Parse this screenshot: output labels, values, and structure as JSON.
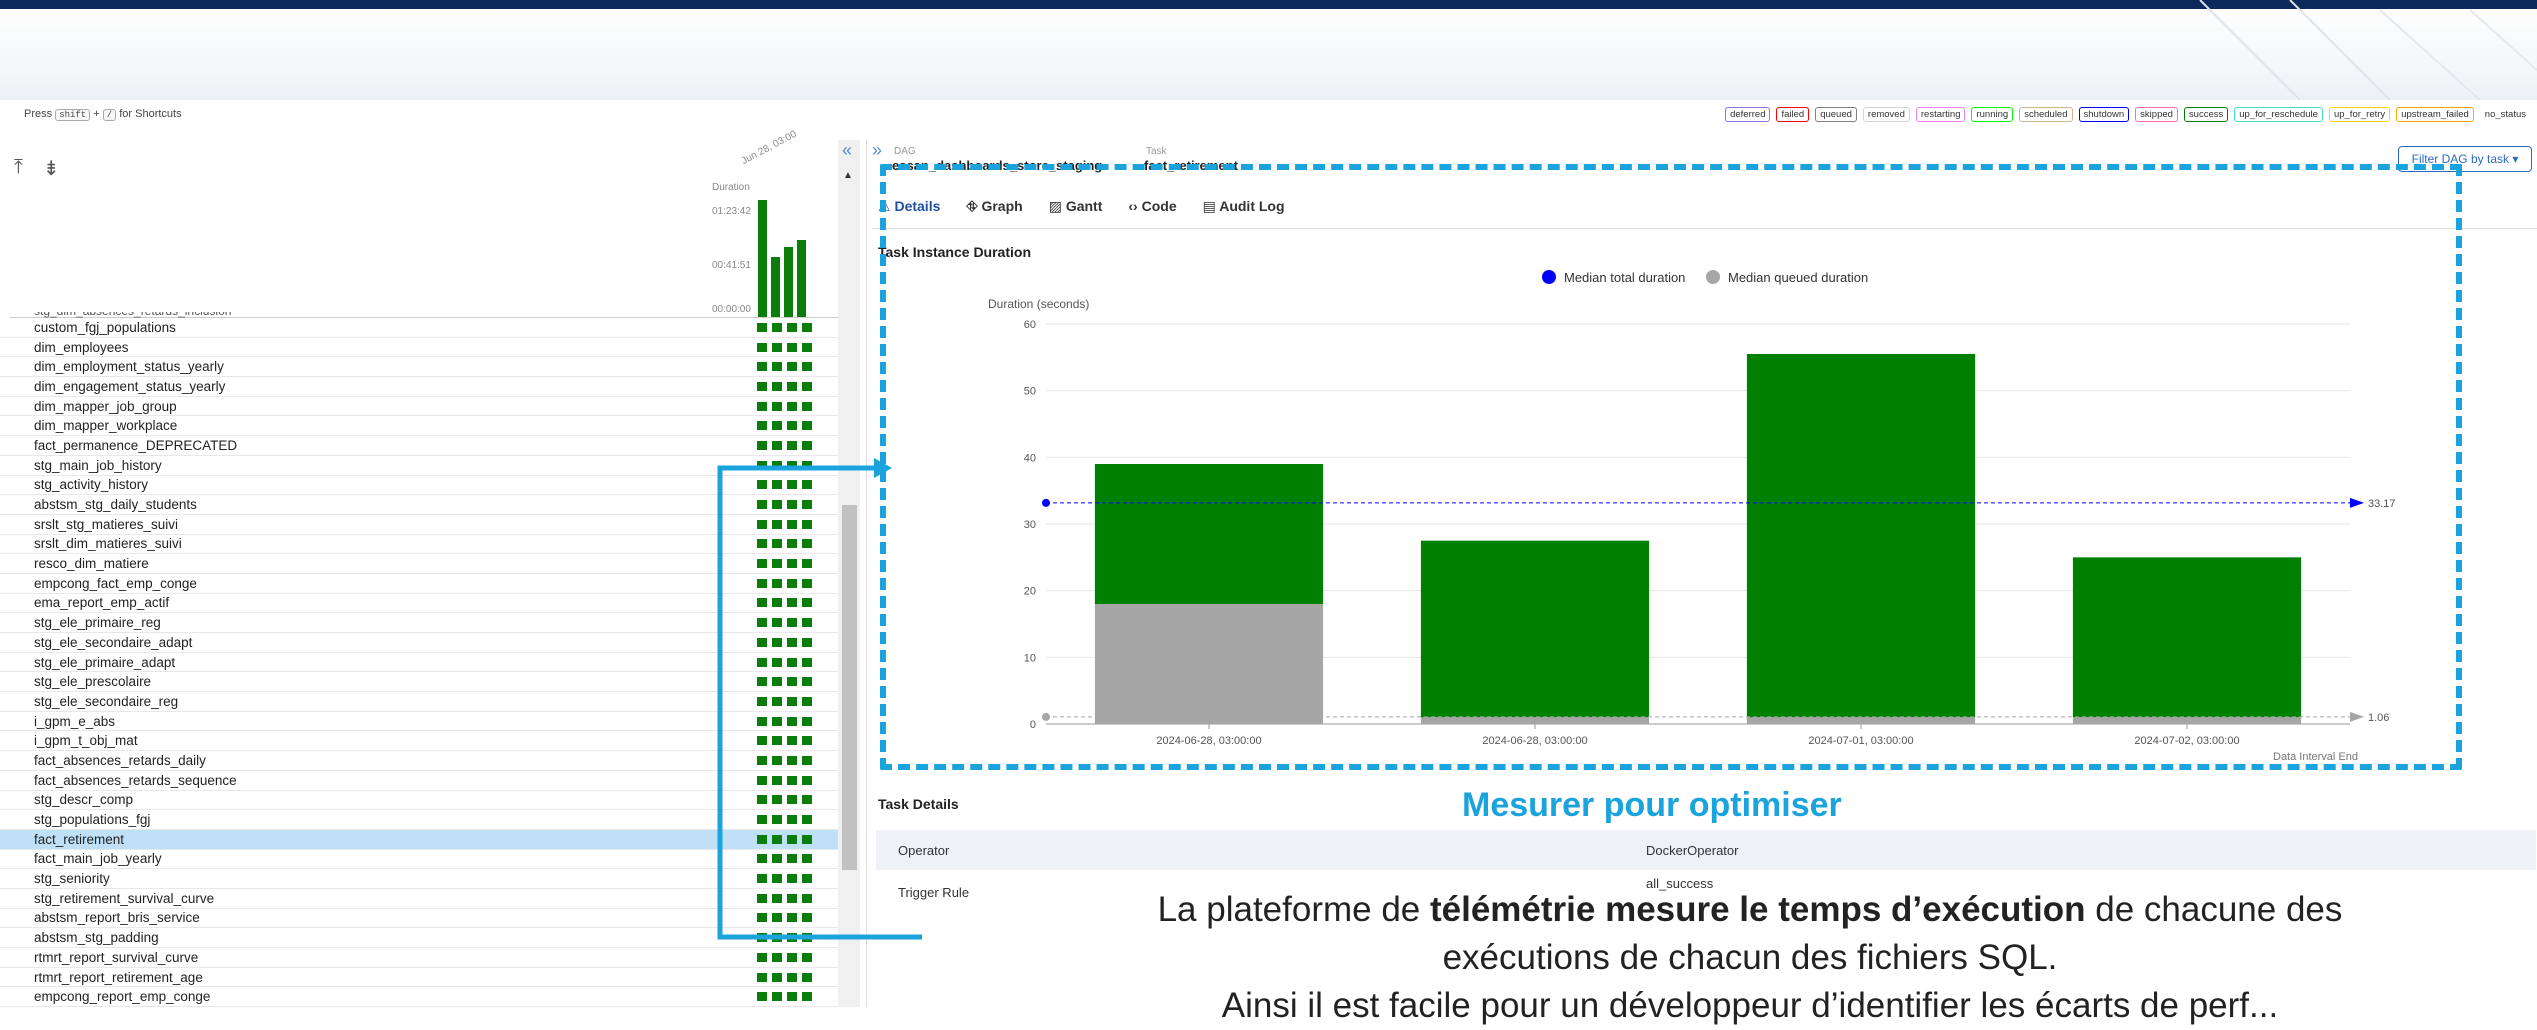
{
  "shortcut_hint": {
    "prefix": "Press",
    "key1": "shift",
    "plus": "+",
    "key2": "/",
    "suffix": "for Shortcuts"
  },
  "status_legend": [
    "deferred",
    "failed",
    "queued",
    "removed",
    "restarting",
    "running",
    "scheduled",
    "shutdown",
    "skipped",
    "success",
    "up_for_reschedule",
    "up_for_retry",
    "upstream_failed",
    "no_status"
  ],
  "status_colors": {
    "deferred": "#9370db",
    "failed": "#ff0000",
    "queued": "#808080",
    "removed": "#d3d3d3",
    "restarting": "#ee82ee",
    "running": "#00ff00",
    "scheduled": "#d2b48c",
    "shutdown": "#0000ff",
    "skipped": "#ff69b4",
    "success": "#008000",
    "up_for_reschedule": "#40e0d0",
    "up_for_retry": "#ffd700",
    "upstream_failed": "#ffa500",
    "no_status": "#ffffff"
  },
  "grid": {
    "duration_label": "Duration",
    "duration_ticks": [
      "01:23:42",
      "00:41:51",
      "00:00:00"
    ],
    "date_header": "Jun 28, 03:00",
    "run_durations_fraction": [
      1.0,
      0.52,
      0.6,
      0.66
    ],
    "partial_top_row": "stg_dim_absences_retards_inclusion",
    "tasks": [
      "custom_fgj_populations",
      "dim_employees",
      "dim_employment_status_yearly",
      "dim_engagement_status_yearly",
      "dim_mapper_job_group",
      "dim_mapper_workplace",
      "fact_permanence_DEPRECATED",
      "stg_main_job_history",
      "stg_activity_history",
      "abstsm_stg_daily_students",
      "srslt_stg_matieres_suivi",
      "srslt_dim_matieres_suivi",
      "resco_dim_matiere",
      "empcong_fact_emp_conge",
      "ema_report_emp_actif",
      "stg_ele_primaire_reg",
      "stg_ele_secondaire_adapt",
      "stg_ele_primaire_adapt",
      "stg_ele_prescolaire",
      "stg_ele_secondaire_reg",
      "i_gpm_e_abs",
      "i_gpm_t_obj_mat",
      "fact_absences_retards_daily",
      "fact_absences_retards_sequence",
      "stg_descr_comp",
      "stg_populations_fgj",
      "fact_retirement",
      "fact_main_job_yearly",
      "stg_seniority",
      "stg_retirement_survival_curve",
      "abstsm_report_bris_service",
      "abstsm_stg_padding",
      "rtmrt_report_survival_curve",
      "rtmrt_report_retirement_age",
      "empcong_report_emp_conge"
    ],
    "selected_task": "fact_retirement"
  },
  "breadcrumb": {
    "dag_label": "DAG",
    "dag_value": "essan_dashboards_store_staging",
    "task_label": "Task",
    "task_value": "fact_retirement"
  },
  "filter_button": "Filter DAG by task",
  "tabs": [
    "Details",
    "Graph",
    "Gantt",
    "Code",
    "Audit Log"
  ],
  "tab_icons": [
    "warning-icon",
    "graph-icon",
    "gantt-icon",
    "code-icon",
    "file-icon"
  ],
  "chart_title": "Task Instance Duration",
  "chart_data": {
    "type": "bar",
    "title": "Task Instance Duration",
    "ylabel": "Duration (seconds)",
    "xlabel": "Data Interval End",
    "ylim": [
      0,
      60
    ],
    "yticks": [
      0,
      10,
      20,
      30,
      40,
      50,
      60
    ],
    "categories": [
      "2024-06-28, 03:00:00",
      "2024-06-28, 03:00:00",
      "2024-07-01, 03:00:00",
      "2024-07-02, 03:00:00"
    ],
    "series": [
      {
        "name": "Median total duration",
        "color": "#0000ff",
        "values": [
          33.17,
          33.17,
          33.17,
          33.17
        ],
        "label": "33.17"
      },
      {
        "name": "Median queued duration",
        "color": "#a6a6a6",
        "values": [
          1.06,
          1.06,
          1.06,
          1.06
        ],
        "label": "1.06"
      }
    ],
    "bars_queued": [
      18,
      1,
      1,
      1
    ],
    "bars_total": [
      39,
      27.5,
      55.5,
      25
    ],
    "bar_colors": {
      "queued": "#a6a6a6",
      "run": "#008000"
    },
    "legend_position": "top-center",
    "grid": true
  },
  "task_details": {
    "title": "Task Details",
    "rows": [
      {
        "key": "Operator",
        "value": "DockerOperator"
      },
      {
        "key": "Trigger Rule",
        "value": "all_success"
      }
    ]
  },
  "overlay": {
    "heading": "Mesurer pour optimiser",
    "line1_a": "La plateforme de ",
    "line1_b": "télémétrie mesure le temps d’exécution",
    "line1_c": " de chacune des",
    "line2": "exécutions de chacun des fichiers SQL.",
    "line3": "Ainsi il est facile pour un développeur d’identifier les écarts de perf..."
  }
}
